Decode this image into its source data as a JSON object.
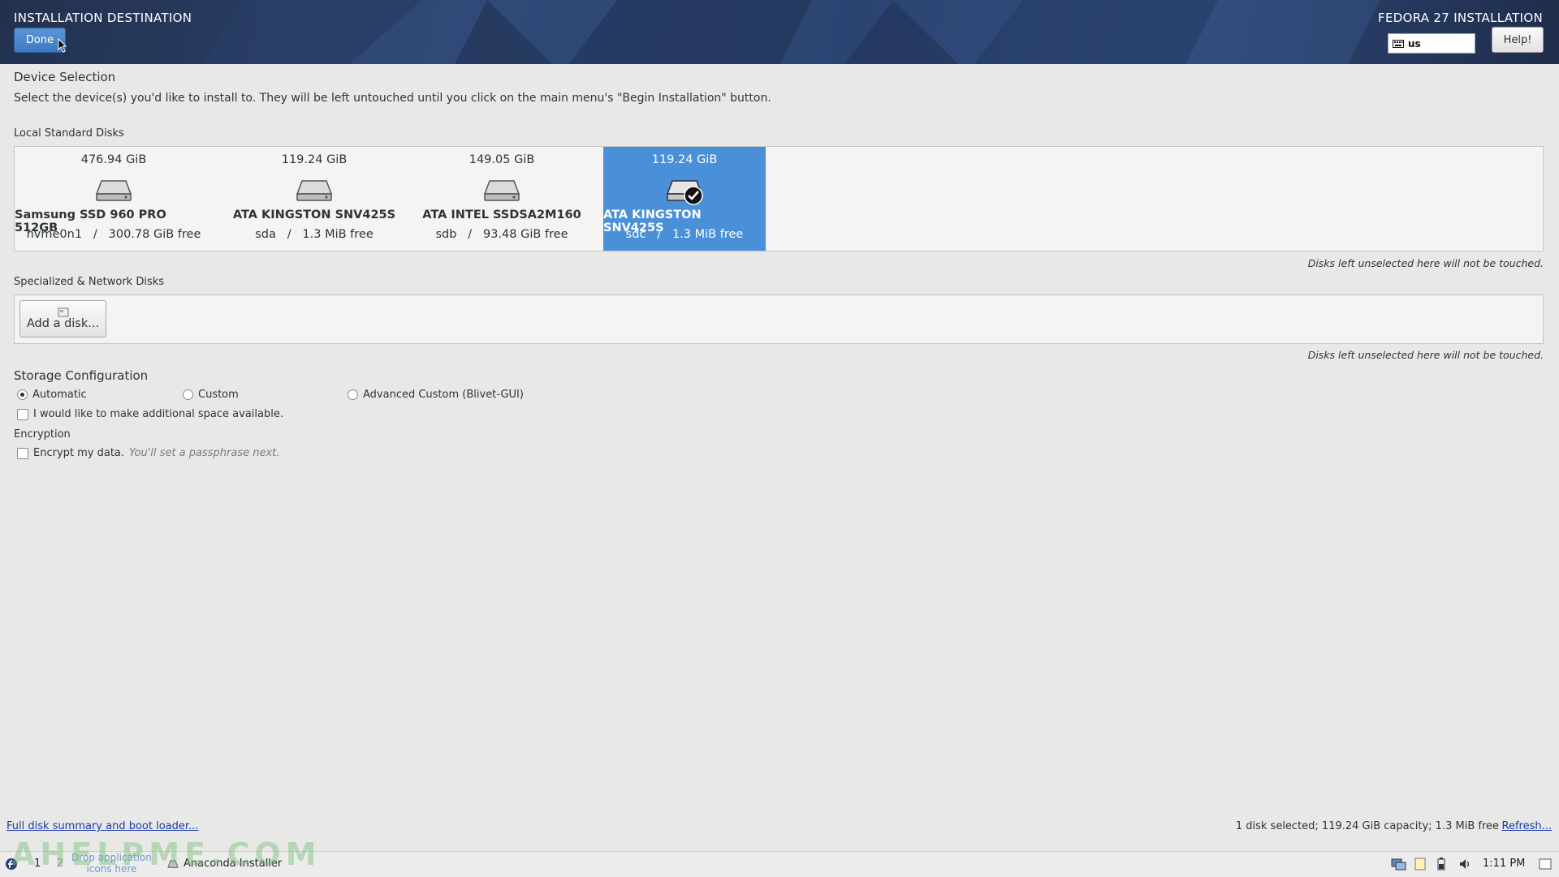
{
  "header": {
    "title": "INSTALLATION DESTINATION",
    "product": "FEDORA 27 INSTALLATION",
    "done_label": "Done",
    "keyboard_layout": "us",
    "help_label": "Help!"
  },
  "device_selection": {
    "title": "Device Selection",
    "description": "Select the device(s) you'd like to install to.  They will be left untouched until you click on the main menu's \"Begin Installation\" button."
  },
  "local_disks": {
    "title": "Local Standard Disks",
    "note": "Disks left unselected here will not be touched.",
    "disks": [
      {
        "size": "476.94 GiB",
        "model": "Samsung SSD 960 PRO 512GB",
        "device": "nvme0n1",
        "free": "300.78 GiB free",
        "selected": false
      },
      {
        "size": "119.24 GiB",
        "model": "ATA KINGSTON SNV425S",
        "device": "sda",
        "free": "1.3 MiB free",
        "selected": false
      },
      {
        "size": "149.05 GiB",
        "model": "ATA INTEL SSDSA2M160",
        "device": "sdb",
        "free": "93.48 GiB free",
        "selected": false
      },
      {
        "size": "119.24 GiB",
        "model": "ATA KINGSTON SNV425S",
        "device": "sdc",
        "free": "1.3 MiB free",
        "selected": true
      }
    ],
    "separator": "/"
  },
  "network_disks": {
    "title": "Specialized & Network Disks",
    "add_label": "Add a disk...",
    "note": "Disks left unselected here will not be touched."
  },
  "storage": {
    "title": "Storage Configuration",
    "options": [
      "Automatic",
      "Custom",
      "Advanced Custom (Blivet-GUI)"
    ],
    "selected": "Automatic",
    "reclaim_label": "I would like to make additional space available.",
    "reclaim_checked": false
  },
  "encryption": {
    "title": "Encryption",
    "label": "Encrypt my data.",
    "hint": "You'll set a passphrase next.",
    "checked": false
  },
  "footer": {
    "summary_link": "Full disk summary and boot loader...",
    "status": "1 disk selected; 119.24 GiB capacity; 1.3 MiB free",
    "refresh_link": "Refresh..."
  },
  "taskbar": {
    "workspace_1": "1",
    "workspace_2": "2",
    "drop_hint_1": "Drop application",
    "drop_hint_2": "icons here",
    "window_title": "Anaconda Installer",
    "clock": "1:11 PM",
    "watermark": "AHELPME.COM"
  },
  "colors": {
    "accent": "#4a90d9",
    "header_bg": "#2d4370",
    "link": "#1b3aa8"
  }
}
